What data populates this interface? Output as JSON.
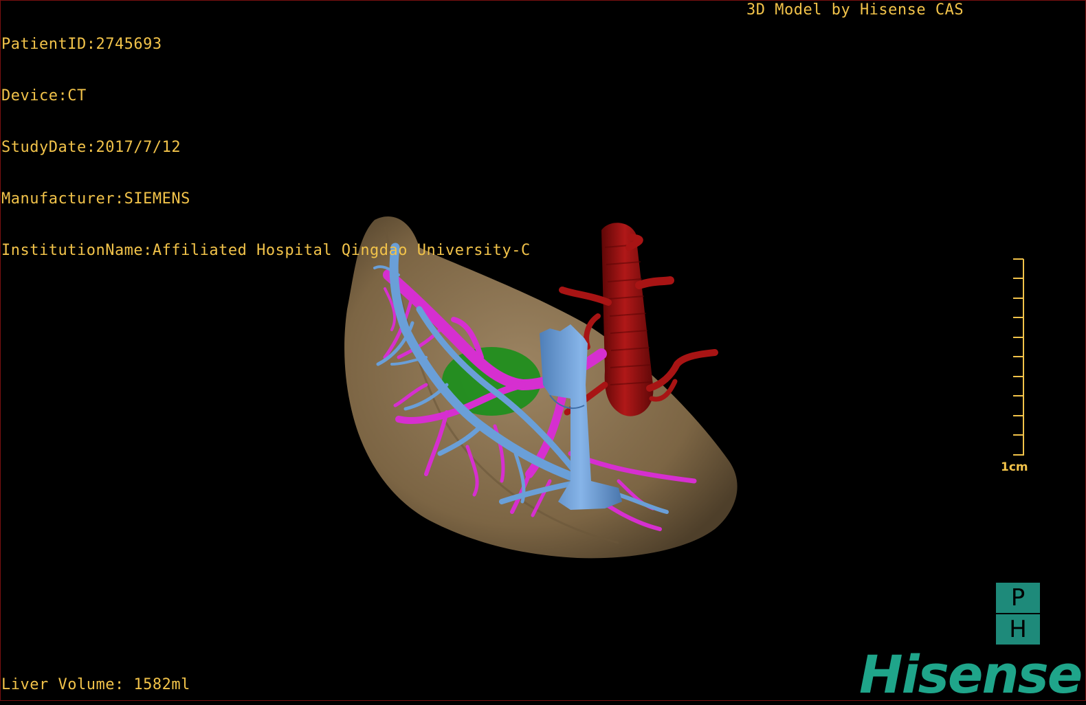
{
  "header": {
    "patient_id": "PatientID:2745693",
    "device": "Device:CT",
    "study_date": "StudyDate:2017/7/12",
    "manufacturer": "Manufacturer:SIEMENS",
    "institution": "InstitutionName:Affiliated Hospital Qingdao University-C"
  },
  "credit": "3D Model by Hisense CAS",
  "footer": {
    "liver_volume": "Liver Volume: 1582ml"
  },
  "scale_bar": {
    "label": "1cm",
    "ticks": 11
  },
  "orientation_cube": {
    "top": "P",
    "bottom": "H"
  },
  "logo": "Hisense",
  "model": {
    "structures": [
      "liver-surface",
      "portal-vein",
      "hepatic-vein",
      "inferior-vena-cava",
      "aorta",
      "lesion"
    ]
  },
  "colors": {
    "text": "#f2c34a",
    "liver": "#8a7250",
    "portal_vein": "#d62fd0",
    "hepatic_vein": "#6a9fd8",
    "aorta": "#a01010",
    "lesion": "#1c8f1c",
    "brand": "#1fa58a"
  }
}
